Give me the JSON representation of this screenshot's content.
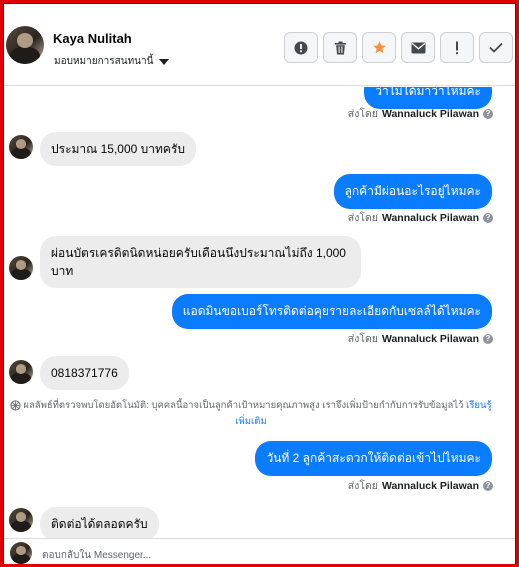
{
  "contact": {
    "name": "Kaya Nulitah",
    "assign_label": "มอบหมายการสนทนานี้"
  },
  "actions": [
    {
      "icon": "alert-circle-icon",
      "name": "mark-spam-button"
    },
    {
      "icon": "trash-icon",
      "name": "delete-button"
    },
    {
      "icon": "star-icon",
      "name": "star-button",
      "color": "#f7923b"
    },
    {
      "icon": "envelope-icon",
      "name": "mark-unread-button"
    },
    {
      "icon": "exclamation-icon",
      "name": "follow-up-button"
    },
    {
      "icon": "checkmark-icon",
      "name": "done-button"
    }
  ],
  "messages": {
    "out_top_partial": "ว่าไม่ได้มาว่าไหมคะ",
    "sent_by_prefix": "ส่งโดย",
    "agent": "Wannaluck Pilawan",
    "in_1": "ประมาณ 15,000 บาทครับ",
    "out_1": "ลูกค้ามีผ่อนอะไรอยู่ไหมคะ",
    "in_2": "ผ่อนบัตรเครดิตนิดหน่อยครับเดือนนึงประมาณไม่ถึง 1,000 บาท",
    "out_2": "แอดมินขอเบอร์โทรติดต่อคุยรายละเอียดกับเซลล์ได้ไหมคะ",
    "in_3": "0818371776",
    "auto_note": "ผลลัพธ์ที่ตรวจพบโดยอัตโนมัติ: บุคคลนี้อาจเป็นลูกค้าเป้าหมายคุณภาพสูง เราจึงเพิ่มป้ายกำกับการรับข้อมูลไว้",
    "auto_note_link": "เรียนรู้เพิ่มเติม",
    "out_3": "วันที่ 2 ลูกค้าสะดวกให้ติดต่อเข้าไปไหมคะ",
    "in_4": "ติดต่อได้ตลอดครับ"
  },
  "composer": {
    "placeholder": "ตอบกลับใน Messenger..."
  },
  "colors": {
    "outgoing_bubble": "#0a7cff",
    "incoming_bubble": "#ececec",
    "frame": "#e00000"
  }
}
